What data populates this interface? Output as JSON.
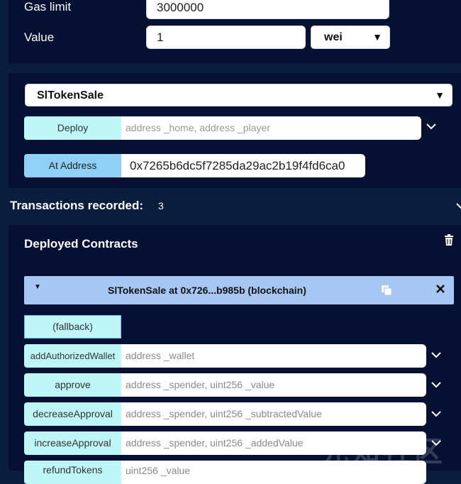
{
  "gas_limit": {
    "label": "Gas limit",
    "value": "3000000"
  },
  "value_field": {
    "label": "Value",
    "value": "1",
    "unit": "wei"
  },
  "contract_select": {
    "selected": "SlTokenSale"
  },
  "deploy": {
    "button_label": "Deploy",
    "placeholder": "address _home, address _player"
  },
  "at_address": {
    "button_label": "At Address",
    "value": "0x7265b6dc5f7285da29ac2b19f4fd6ca0"
  },
  "transactions": {
    "label": "Transactions recorded:",
    "count": "3"
  },
  "deployed": {
    "title": "Deployed Contracts"
  },
  "instance": {
    "title": "SlTokenSale at 0x726...b985b (blockchain)"
  },
  "functions": [
    {
      "name": "(fallback)",
      "params": ""
    },
    {
      "name": "addAuthorizedWallet",
      "params": "address _wallet"
    },
    {
      "name": "approve",
      "params": "address _spender, uint256 _value"
    },
    {
      "name": "decreaseApproval",
      "params": "address _spender, uint256 _subtractedValue"
    },
    {
      "name": "increaseApproval",
      "params": "address _spender, uint256 _addedValue"
    },
    {
      "name": "refundTokens",
      "params": "uint256 _value"
    }
  ],
  "watermark": "先知社区"
}
